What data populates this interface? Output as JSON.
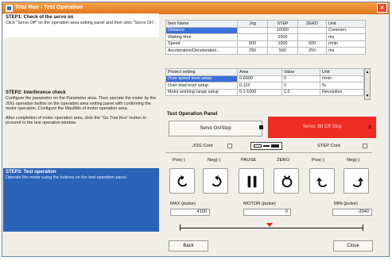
{
  "window": {
    "title": "Trial Run - Test Operation",
    "close": "×"
  },
  "steps": {
    "step1": {
      "title": "STEP1: Check of the servo on",
      "text": "Click \"Servo Off\" on the operation area setting panel and then click \"Servo On\"."
    },
    "step2": {
      "title": "STEP2: Interference check",
      "text1": "Configure the parameter on the Parameter area. Then operate the motor by the JOG operation button on the operation area setting panel with confirming the motor operation. Configure the Max/Min of motor operation area.",
      "text2": "After completion of motor operation area, click the \"Go Trial Run\" button to proceed to the test operation window."
    },
    "step3": {
      "title": "STEP3: Test operation",
      "text": "Operate the motor using the buttons on the test operation panel."
    }
  },
  "param_table": {
    "headers": [
      "Item Name",
      "Jog",
      "STEP",
      "ZERO",
      "Unit"
    ],
    "rows": [
      [
        "Distance",
        "",
        "10000",
        "",
        "Commen."
      ],
      [
        "Waiting time",
        "",
        "2000",
        "",
        "ms"
      ],
      [
        "Speed",
        "500",
        "1000",
        "500",
        "r/min"
      ],
      [
        "Acceleration/Deceleration...",
        "250",
        "500",
        "250",
        "ms"
      ]
    ]
  },
  "protect_table": {
    "headers": [
      "Protect setting",
      "Area",
      "Value",
      "Unit"
    ],
    "rows": [
      [
        "Over-speed level setup",
        "0-6000",
        "0",
        "r/min"
      ],
      [
        "Over-load level setup",
        "0-115",
        "0",
        "%"
      ],
      [
        "Motor working range setup",
        "0.1-1000",
        "1.0",
        "Revolution"
      ]
    ],
    "scroll_up": "▲",
    "scroll_down": "▼"
  },
  "panel": {
    "title": "Test Operation Panel",
    "servo_label": "Servo On/Stop",
    "alarm_text": "Servo: Bit Off Stop",
    "alarm_close": "x",
    "jog_cont": "JOG Cont",
    "step_cont": "STEP Cont",
    "buttons": [
      "Pos(-)",
      "Neg(-)",
      "PAUSE",
      "ZERO",
      "Pos(-)",
      "Neg(-)"
    ]
  },
  "range": {
    "max_label": "MAX (pulse)",
    "max_value": "4100",
    "motor_label": "MOTOR (pulse)",
    "motor_value": "0",
    "min_label": "MIN (pulse)",
    "min_value": "-3940",
    "marker_fraction": 0.49
  },
  "footer": {
    "back": "Back",
    "close": "Close"
  },
  "colors": {
    "title_bar": "#e98a31",
    "alarm": "#ee2c22",
    "step3": "#2b63b8",
    "selected": "#3a6fd8"
  }
}
